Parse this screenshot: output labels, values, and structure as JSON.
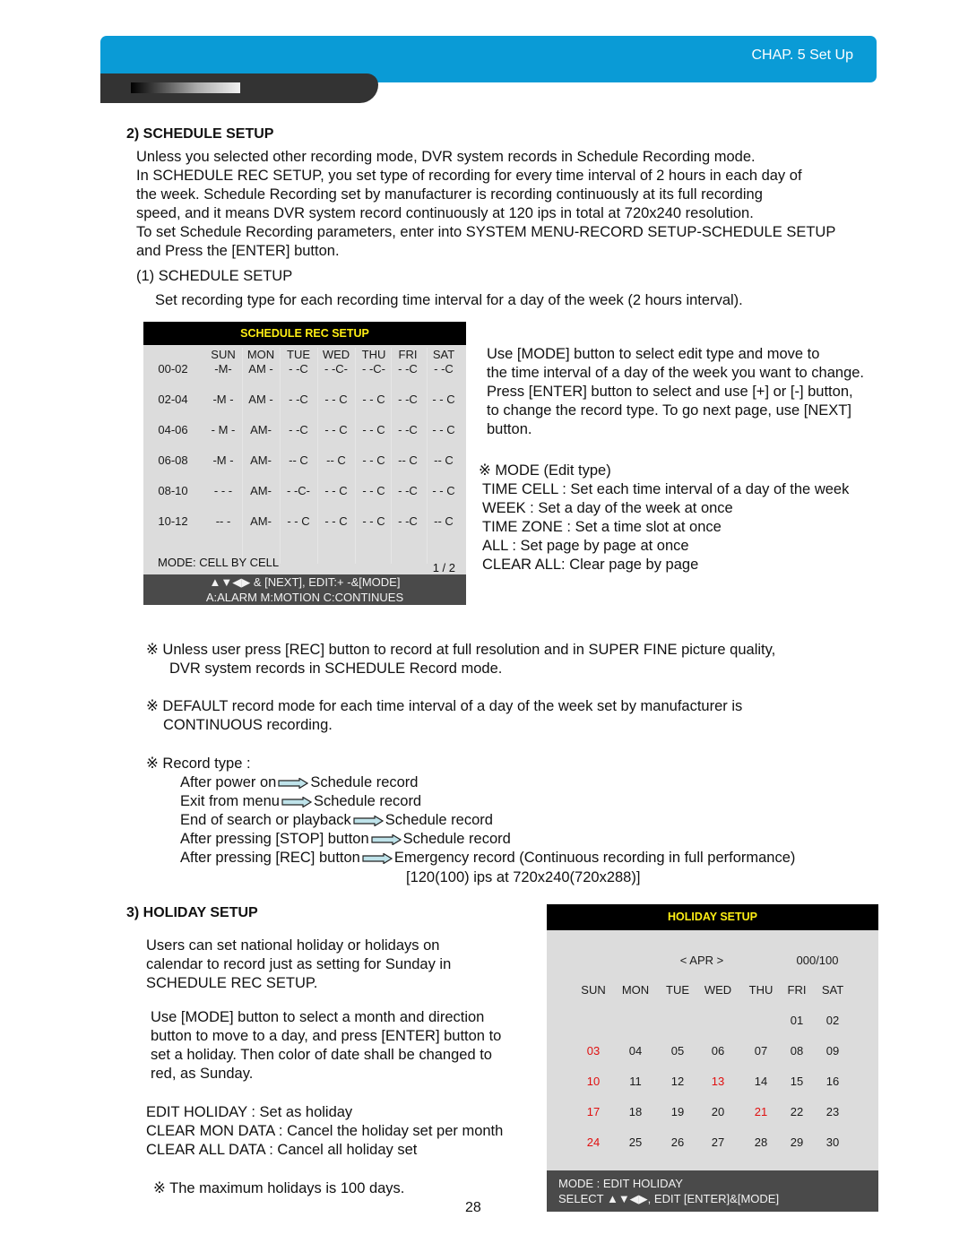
{
  "header": {
    "chapter": "CHAP. 5  Set Up"
  },
  "schedule": {
    "heading": "2) SCHEDULE SETUP",
    "intro": [
      "Unless you selected other recording mode, DVR system records in Schedule Recording mode.",
      "In SCHEDULE REC SETUP, you set type of recording for every time interval of 2 hours in each day of",
      "the week. Schedule Recording set by manufacturer is recording continuously at its full recording",
      "speed, and it means DVR system record continuously at 120 ips in total at 720x240 resolution.",
      "To set Schedule Recording parameters, enter into SYSTEM MENU-RECORD SETUP-SCHEDULE SETUP",
      "and Press the [ENTER] button."
    ],
    "sub_heading": "(1) SCHEDULE SETUP",
    "sub_text": "Set recording type for each recording time interval for a day of the week (2 hours interval).",
    "screen": {
      "title": "SCHEDULE REC SETUP",
      "days": [
        "SUN",
        "MON",
        "TUE",
        "WED",
        "THU",
        "FRI",
        "SAT"
      ],
      "rows": [
        {
          "time": "00-02",
          "cells": [
            "-M-",
            "AM -",
            "- -C",
            "- -C-",
            "- -C-",
            "- -C",
            "- -C"
          ]
        },
        {
          "time": "02-04",
          "cells": [
            "-M -",
            "AM -",
            "- -C",
            "- - C",
            "- - C",
            "- -C",
            "- - C"
          ]
        },
        {
          "time": "04-06",
          "cells": [
            "- M -",
            "AM-",
            "- -C",
            "- - C",
            "- - C",
            "- -C",
            "- - C"
          ]
        },
        {
          "time": "06-08",
          "cells": [
            "-M -",
            "AM-",
            "-- C",
            "-- C",
            "- - C",
            "-- C",
            "-- C"
          ]
        },
        {
          "time": "08-10",
          "cells": [
            "- - -",
            "AM-",
            "- -C-",
            "- - C",
            "- - C",
            "- -C",
            "- - C"
          ]
        },
        {
          "time": "10-12",
          "cells": [
            "-- -",
            "AM-",
            "- - C",
            "- - C",
            "- - C",
            "- -C",
            "-- C"
          ]
        }
      ],
      "mode": "MODE: CELL BY CELL",
      "page": "1 / 2",
      "footer_line1": "▲▼◀▶ & [NEXT], EDIT:+ -&[MODE]",
      "footer_line2": "A:ALARM    M:MOTION   C:CONTINUES"
    },
    "instructions": [
      "Use [MODE] button to select edit type and move to",
      "the time interval of a day of the week you want to change.",
      "Press [ENTER] button to select and use [+] or [-] button,",
      "to change the record type. To go next page, use [NEXT]",
      "button."
    ],
    "mode_heading": "※ MODE (Edit type)",
    "modes": [
      "TIME CELL : Set each time interval of a day of the week",
      "WEEK : Set a day of the week at once",
      "TIME ZONE : Set a time slot at once",
      "ALL : Set page by page at once",
      "CLEAR ALL: Clear page by page"
    ],
    "notes": [
      {
        "line1": "※ Unless user press [REC] button to record at full resolution and in SUPER FINE picture quality,",
        "line2": "DVR system records in SCHEDULE Record mode."
      },
      {
        "line1": "※ DEFAULT record mode for each time interval of a day of the week set by manufacturer is",
        "line2": "CONTINUOUS recording."
      }
    ],
    "record_type_heading": "※ Record type :",
    "record_types": [
      {
        "from": "After power on",
        "to": "Schedule record"
      },
      {
        "from": "Exit from menu",
        "to": "Schedule record"
      },
      {
        "from": "End of search or playback",
        "to": "Schedule record"
      },
      {
        "from": "After pressing [STOP] button",
        "to": "Schedule record"
      },
      {
        "from": "After pressing [REC] button",
        "to": "Emergency record (Continuous recording in full performance)"
      }
    ],
    "record_types_extra": "[120(100) ips at 720x240(720x288)]"
  },
  "holiday": {
    "heading": "3) HOLIDAY SETUP",
    "intro": [
      "Users can set national holiday or holidays on",
      "calendar to record just as setting for Sunday in",
      "SCHEDULE REC SETUP."
    ],
    "usage": [
      "Use [MODE] button to select a month and direction",
      "button to move to a day, and press [ENTER] button to",
      "set a holiday. Then color of date shall be changed to",
      "red, as Sunday."
    ],
    "modes": [
      "EDIT HOLIDAY : Set as holiday",
      "CLEAR MON DATA : Cancel the holiday set per month",
      "CLEAR ALL DATA : Cancel all holiday set"
    ],
    "note": "※ The maximum holidays is 100 days.",
    "screen": {
      "title": "HOLIDAY SETUP",
      "month": "<  APR >",
      "count": "000/100",
      "days": [
        "SUN",
        "MON",
        "TUE",
        "WED",
        "THU",
        "FRI",
        "SAT"
      ],
      "weeks": [
        [
          "",
          "",
          "",
          "",
          "",
          "01",
          "02"
        ],
        [
          "03",
          "04",
          "05",
          "06",
          "07",
          "08",
          "09"
        ],
        [
          "10",
          "11",
          "12",
          "13",
          "14",
          "15",
          "16"
        ],
        [
          "17",
          "18",
          "19",
          "20",
          "21",
          "22",
          "23"
        ],
        [
          "24",
          "25",
          "26",
          "27",
          "28",
          "29",
          "30"
        ]
      ],
      "holidays": [
        "03",
        "10",
        "13",
        "17",
        "21",
        "24"
      ],
      "holiday_color": "#e01010",
      "footer_line1": "MODE : EDIT HOLIDAY",
      "footer_line2": "SELECT ▲▼◀▶,  EDIT [ENTER]&[MODE]"
    }
  },
  "page_number": "28"
}
